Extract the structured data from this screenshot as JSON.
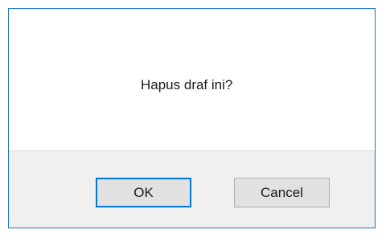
{
  "dialog": {
    "message": "Hapus draf ini?",
    "ok_label": "OK",
    "cancel_label": "Cancel"
  }
}
